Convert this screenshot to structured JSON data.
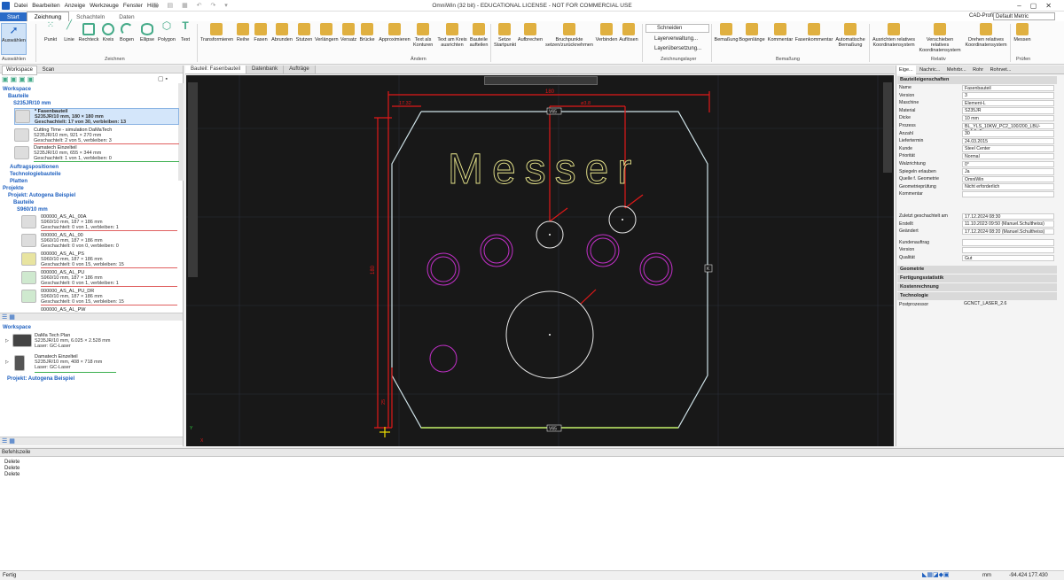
{
  "window": {
    "title": "OmniWin (32 bit) - EDUCATIONAL LICENSE - NOT FOR COMMERCIAL USE",
    "menu": [
      "Datei",
      "Bearbeiten",
      "Anzeige",
      "Werkzeuge",
      "Fenster",
      "Hilfe"
    ]
  },
  "ribbon": {
    "tabs": [
      "Start",
      "Zeichnung",
      "Schachteln",
      "Daten"
    ],
    "cad_profile_label": "CAD-Profil",
    "cad_profile_value": "Default Metric",
    "buttons": {
      "auswaehlen": "Auswählen",
      "punkt": "Punkt",
      "linie": "Linie",
      "rechteck": "Rechteck",
      "kreis": "Kreis",
      "bogen": "Bogen",
      "ellipse": "Ellipse",
      "polygon": "Polygon",
      "text": "Text",
      "transformieren": "Transformieren",
      "reihe": "Reihe",
      "fasen": "Fasen",
      "abrunden": "Abrunden",
      "stutzen": "Stutzen",
      "verlaengern": "Verlängern",
      "versatz": "Versatz",
      "bruecke": "Brücke",
      "approximieren": "Approximieren",
      "text_als_konturen": "Text als Konturen",
      "text_am_kreis": "Text am Kreis ausrichten",
      "bauteile_aufteilen": "Bauteile aufteilen",
      "setze_startpunkt": "Setze Startpunkt",
      "aufbrechen": "Aufbrechen",
      "bruchpunkte": "Bruchpunkte setzen/zurücknehmen",
      "verbinden": "Verbinden",
      "aufloesen": "Auflösen",
      "schneiden": "Schneiden",
      "layerverwaltung": "Layerverwaltung...",
      "layeruebersetzung": "Layerübersetzung...",
      "bemassung": "Bemaßung",
      "bogenlaenge": "Bogenlänge",
      "kommentar": "Kommentar",
      "fasenkommentar": "Fasenkommentar",
      "automatische_bemassung": "Automatische Bemaßung",
      "ausrichten_rel": "Ausrichten relatives Koordinatensystem",
      "verschieben_rel": "Verschieben relatives Koordinatensystem",
      "drehen_rel": "Drehen relatives Koordinatensystem",
      "messen": "Messen"
    },
    "groups": {
      "auswaehlen": "Auswählen",
      "zeichnen": "Zeichnen",
      "aendern": "Ändern",
      "zeichnungslayer": "Zeichnungslayer",
      "bemassung": "Bemaßung",
      "relativ": "Relativ",
      "pruefen": "Prüfen"
    }
  },
  "left_panel": {
    "tabs": [
      "Workspace",
      "Scan"
    ],
    "tree": {
      "workspace": "Workspace",
      "bauteile": "Bauteile",
      "material": "S235JR/10 mm",
      "parts": [
        {
          "name": "* Fasenbauteil",
          "tag": "",
          "l2": "S235JR/10 mm, 180 × 180 mm",
          "l3": "Geschachtelt: 17 von 30, verbleiben: 13"
        },
        {
          "name": "Cutting Time - simulation DaMaTech",
          "tag": "",
          "l2": "S235JR/10 mm, 921 × 270 mm",
          "l3": "Geschachtelt: 2 von 5, verbleiben: 3"
        },
        {
          "name": "Damatech Einzelteil",
          "tag": "",
          "l2": "S235JR/10 mm, 655 × 344 mm",
          "l3": "Geschachtelt: 1 von 1, verbleiben: 0"
        }
      ],
      "auftragspositionen": "Auftragspositionen",
      "technologiebauteile": "Technologiebauteile",
      "platten": "Platten",
      "projekte": "Projekte",
      "projekt": "Projekt: Autogena Beispiel",
      "projekt_bauteile": "Bauteile",
      "projekt_material": "S960/10 mm",
      "project_parts": [
        {
          "name": "000000_AS_AL_00A",
          "l2": "S960/10 mm, 187 × 186 mm",
          "l3": "Geschachtelt: 0 von 1, verbleiben: 1"
        },
        {
          "name": "000000_AS_AL_00",
          "l2": "S960/10 mm, 187 × 186 mm",
          "l3": "Geschachtelt: 0 von 0, verbleiben: 0"
        },
        {
          "name": "000000_AS_AL_PS",
          "l2": "S960/10 mm, 187 × 186 mm",
          "l3": "Geschachtelt: 0 von 15, verbleiben: 15"
        },
        {
          "name": "000000_AS_AL_PU",
          "l2": "S960/10 mm, 187 × 186 mm",
          "l3": "Geschachtelt: 0 von 1, verbleiben: 1"
        },
        {
          "name": "000000_AS_AL_PU_DR",
          "l2": "S960/10 mm, 187 × 186 mm",
          "l3": "Geschachtelt: 0 von 15, verbleiben: 15"
        },
        {
          "name": "000000_AS_AL_PW",
          "l2": "",
          "l3": ""
        }
      ]
    },
    "lower": {
      "workspace": "Workspace",
      "items": [
        {
          "name": "DaMa Tech Plan",
          "l2": "S235JR/10 mm, 6.025 × 2.528 mm",
          "l3": "Laser: GC-Laser"
        },
        {
          "name": "Damatech Einzelteil",
          "l2": "S235JR/10 mm, 408 × 718 mm",
          "l3": "Laser: GC-Laser"
        }
      ],
      "projekt": "Projekt: Autogena Beispiel"
    }
  },
  "doc_tabs": [
    "Bauteil: Fasenbauteil",
    "Datenbank",
    "Aufträge"
  ],
  "drawing": {
    "text": "Messer",
    "dim_top": "180",
    "dim_left": "180",
    "dim_small_a": "17.32",
    "dim_small_b": "ø3.8",
    "dim_side": "25",
    "label_v": "V65",
    "label_k": "K",
    "axis_y": "Y",
    "axis_x": "X"
  },
  "properties": {
    "tabs": [
      "Eige...",
      "Nachric...",
      "Mehrbr...",
      "Rohr",
      "Rohrvet..."
    ],
    "section_main": "Bauteileigenschaften",
    "rows": [
      {
        "k": "Name",
        "v": "Fasenbauteil"
      },
      {
        "k": "Version",
        "v": "3"
      },
      {
        "k": "Maschine",
        "v": "Element-L"
      },
      {
        "k": "Material",
        "v": "S235JR"
      },
      {
        "k": "Dicke",
        "v": "10 mm"
      },
      {
        "k": "Prozess",
        "v": "BL_YLS_10KW_PC2_100/200_LBU-S_1.5_F"
      },
      {
        "k": "Anzahl",
        "v": "30"
      },
      {
        "k": "Liefertermin",
        "v": "24.03.2015"
      },
      {
        "k": "Kunde",
        "v": "Steel Center"
      },
      {
        "k": "Priorität",
        "v": "Normal"
      },
      {
        "k": "Walzrichtung",
        "v": "0°"
      },
      {
        "k": "Spiegeln erlauben",
        "v": "Ja"
      },
      {
        "k": "Quelle f. Geometrie",
        "v": "OmniWin"
      },
      {
        "k": "Geometrieprüfung",
        "v": "Nicht erforderlich"
      },
      {
        "k": "Kommentar",
        "v": ""
      }
    ],
    "rows2": [
      {
        "k": "Zuletzt geschachtelt am",
        "v": "17.12.2024 08:30"
      },
      {
        "k": "Erstellt",
        "v": "11.10.2023 09:50 (Manuel.Schultheiss)"
      },
      {
        "k": "Geändert",
        "v": "17.12.2024 08:20 (Manuel.Schultheiss)"
      }
    ],
    "rows3": [
      {
        "k": "Kundenauftrag",
        "v": ""
      },
      {
        "k": "Version",
        "v": ""
      },
      {
        "k": "Qualität",
        "v": "Gut"
      }
    ],
    "sections": [
      "Geometrie",
      "Fertigungsstatistik",
      "Kostenrechnung",
      "Technologie"
    ],
    "postprocessor_key": "Postprozessor",
    "postprocessor_val": "GCNCT_LASER_2.6"
  },
  "command": {
    "title": "Befehlszeile",
    "lines": [
      "Delete",
      "Delete",
      "Delete"
    ]
  },
  "status": {
    "left": "Fertig",
    "unit": "mm",
    "coords": "-94.424   177.430"
  }
}
